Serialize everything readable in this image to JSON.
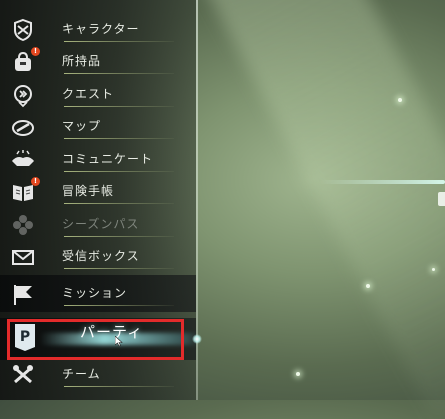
{
  "menu": {
    "items": [
      {
        "label": "キャラクター",
        "icon": "character-shield-icon",
        "badge": ""
      },
      {
        "label": "所持品",
        "icon": "bag-icon",
        "badge": "!"
      },
      {
        "label": "クエスト",
        "icon": "quest-scroll-icon",
        "badge": ""
      },
      {
        "label": "マップ",
        "icon": "compass-icon",
        "badge": ""
      },
      {
        "label": "コミュニケート",
        "icon": "handshake-icon",
        "badge": ""
      },
      {
        "label": "冒険手帳",
        "icon": "book-icon",
        "badge": "!"
      },
      {
        "label": "シーズンパス",
        "icon": "season-pass-icon",
        "badge": "",
        "disabled": true
      },
      {
        "label": "受信ボックス",
        "icon": "envelope-icon",
        "badge": ""
      }
    ],
    "mission": {
      "label": "ミッション",
      "icon": "flag-icon"
    },
    "party": {
      "label": "パーティ",
      "icon": "party-p-icon"
    },
    "team": {
      "label": "チーム",
      "icon": "team-crossed-icon"
    }
  },
  "colors": {
    "highlight": "#e32b2b",
    "badge": "#e3471f",
    "accent_underline": "#c8d796"
  }
}
